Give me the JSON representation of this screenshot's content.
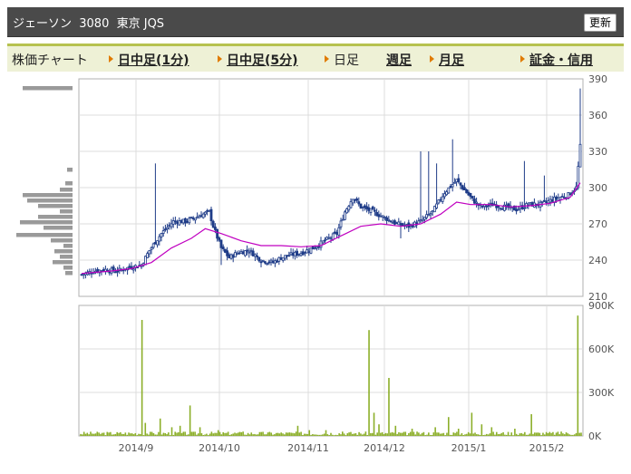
{
  "header": {
    "title": "ジェーソン  3080  東京 JQS",
    "refresh_label": "更新"
  },
  "tabs": [
    {
      "label": "株価チャート",
      "arrow": false,
      "link": false
    },
    {
      "label": "日中足(1分)",
      "arrow": true,
      "link": true
    },
    {
      "label": "日中足(5分)",
      "arrow": true,
      "link": true
    },
    {
      "label": "日足",
      "arrow": true,
      "link": false
    },
    {
      "label": "週足",
      "arrow": false,
      "link": true
    },
    {
      "label": "月足",
      "arrow": true,
      "link": true
    },
    {
      "label": "証金・信用",
      "arrow": true,
      "link": true
    }
  ],
  "colors": {
    "candle": "#1f3c88",
    "moving_average": "#c000c0",
    "volume_bar": "#8caf2a",
    "volume_profile": "#9a9a9a",
    "grid": "#dcdcdc",
    "frame": "#b0b0b0"
  },
  "chart_data": [
    {
      "type": "candlestick",
      "title": "",
      "y_ticks": [
        "390",
        "360",
        "330",
        "300",
        "270",
        "240",
        "210"
      ],
      "ylim": [
        210,
        390
      ],
      "x_tick_labels": [
        "2014/9",
        "2014/10",
        "2014/11",
        "2014/12",
        "2015/1",
        "2015/2"
      ],
      "grid": true,
      "anchors": [
        [
          0,
          228
        ],
        [
          6,
          231
        ],
        [
          12,
          232
        ],
        [
          18,
          231
        ],
        [
          24,
          234
        ],
        [
          30,
          236
        ],
        [
          34,
          248
        ],
        [
          40,
          262
        ],
        [
          46,
          272
        ],
        [
          52,
          272
        ],
        [
          58,
          276
        ],
        [
          64,
          280
        ],
        [
          66,
          268
        ],
        [
          70,
          250
        ],
        [
          74,
          242
        ],
        [
          78,
          246
        ],
        [
          84,
          248
        ],
        [
          90,
          240
        ],
        [
          96,
          238
        ],
        [
          100,
          242
        ],
        [
          104,
          244
        ],
        [
          110,
          246
        ],
        [
          116,
          250
        ],
        [
          120,
          254
        ],
        [
          124,
          258
        ],
        [
          128,
          262
        ],
        [
          132,
          280
        ],
        [
          136,
          292
        ],
        [
          140,
          284
        ],
        [
          146,
          280
        ],
        [
          152,
          275
        ],
        [
          158,
          270
        ],
        [
          164,
          268
        ],
        [
          170,
          272
        ],
        [
          176,
          280
        ],
        [
          182,
          296
        ],
        [
          188,
          306
        ],
        [
          192,
          298
        ],
        [
          196,
          290
        ],
        [
          200,
          284
        ],
        [
          206,
          286
        ],
        [
          212,
          284
        ],
        [
          218,
          282
        ],
        [
          224,
          286
        ],
        [
          230,
          286
        ],
        [
          236,
          290
        ],
        [
          240,
          292
        ],
        [
          244,
          294
        ],
        [
          248,
          300
        ],
        [
          250,
          334
        ]
      ],
      "moving_average": [
        [
          0,
          229
        ],
        [
          15,
          231
        ],
        [
          25,
          233
        ],
        [
          35,
          238
        ],
        [
          45,
          250
        ],
        [
          55,
          258
        ],
        [
          62,
          266
        ],
        [
          70,
          262
        ],
        [
          80,
          256
        ],
        [
          90,
          252
        ],
        [
          100,
          252
        ],
        [
          110,
          251
        ],
        [
          120,
          252
        ],
        [
          130,
          260
        ],
        [
          140,
          268
        ],
        [
          150,
          270
        ],
        [
          160,
          268
        ],
        [
          170,
          270
        ],
        [
          180,
          278
        ],
        [
          188,
          288
        ],
        [
          195,
          286
        ],
        [
          205,
          286
        ],
        [
          215,
          284
        ],
        [
          225,
          285
        ],
        [
          235,
          287
        ],
        [
          245,
          292
        ],
        [
          250,
          304
        ]
      ],
      "series": [],
      "volume_profile_note": "horizontal volume-at-price bars on left side"
    },
    {
      "type": "bar",
      "title": "",
      "y_ticks": [
        "900K",
        "600K",
        "300K",
        "0K"
      ],
      "ylim": [
        0,
        900000
      ],
      "x_tick_labels": [
        "2014/9",
        "2014/10",
        "2014/11",
        "2014/12",
        "2015/1",
        "2015/2"
      ],
      "spikes": [
        [
          37,
          800000
        ],
        [
          39,
          90000
        ],
        [
          48,
          120000
        ],
        [
          55,
          60000
        ],
        [
          60,
          70000
        ],
        [
          66,
          210000
        ],
        [
          72,
          60000
        ],
        [
          83,
          40000
        ],
        [
          98,
          30000
        ],
        [
          118,
          20000
        ],
        [
          131,
          70000
        ],
        [
          138,
          40000
        ],
        [
          148,
          40000
        ],
        [
          158,
          30000
        ],
        [
          174,
          730000
        ],
        [
          177,
          160000
        ],
        [
          180,
          80000
        ],
        [
          186,
          400000
        ],
        [
          190,
          70000
        ],
        [
          200,
          50000
        ],
        [
          214,
          60000
        ],
        [
          222,
          130000
        ],
        [
          228,
          50000
        ],
        [
          236,
          160000
        ],
        [
          242,
          80000
        ],
        [
          248,
          60000
        ],
        [
          262,
          50000
        ],
        [
          272,
          150000
        ],
        [
          290,
          30000
        ],
        [
          300,
          830000
        ]
      ]
    }
  ]
}
